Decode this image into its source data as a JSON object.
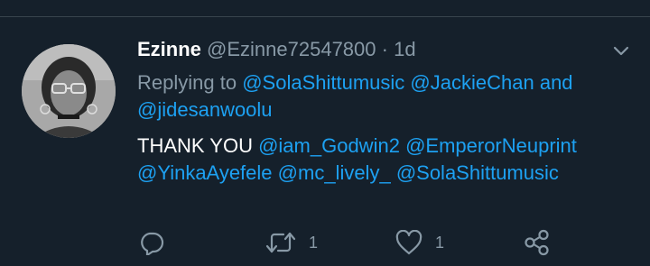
{
  "tweet": {
    "display_name": "Ezinne",
    "handle": "@Ezinne72547800",
    "separator": "·",
    "time": "1d",
    "replying": {
      "prefix": "Replying to",
      "mention_1": "@SolaShittumusic",
      "mention_2": "@JackieChan",
      "conjunction": "and",
      "mention_3": "@jidesanwoolu"
    },
    "text": {
      "lead": "THANK YOU",
      "mention_1": "@iam_Godwin2",
      "mention_2": "@EmperorNeuprint",
      "mention_3": "@YinkaAyefele",
      "mention_4": "@mc_lively_",
      "mention_5": "@SolaShittumusic"
    },
    "actions": {
      "reply_icon": "speech-bubble-icon",
      "retweet_icon": "retweet-icon",
      "retweet_count": "1",
      "like_icon": "heart-icon",
      "like_count": "1",
      "share_icon": "share-icon"
    }
  },
  "colors": {
    "background": "#15202b",
    "link": "#1da1f2",
    "muted": "#8899a6",
    "divider": "#38444d"
  }
}
